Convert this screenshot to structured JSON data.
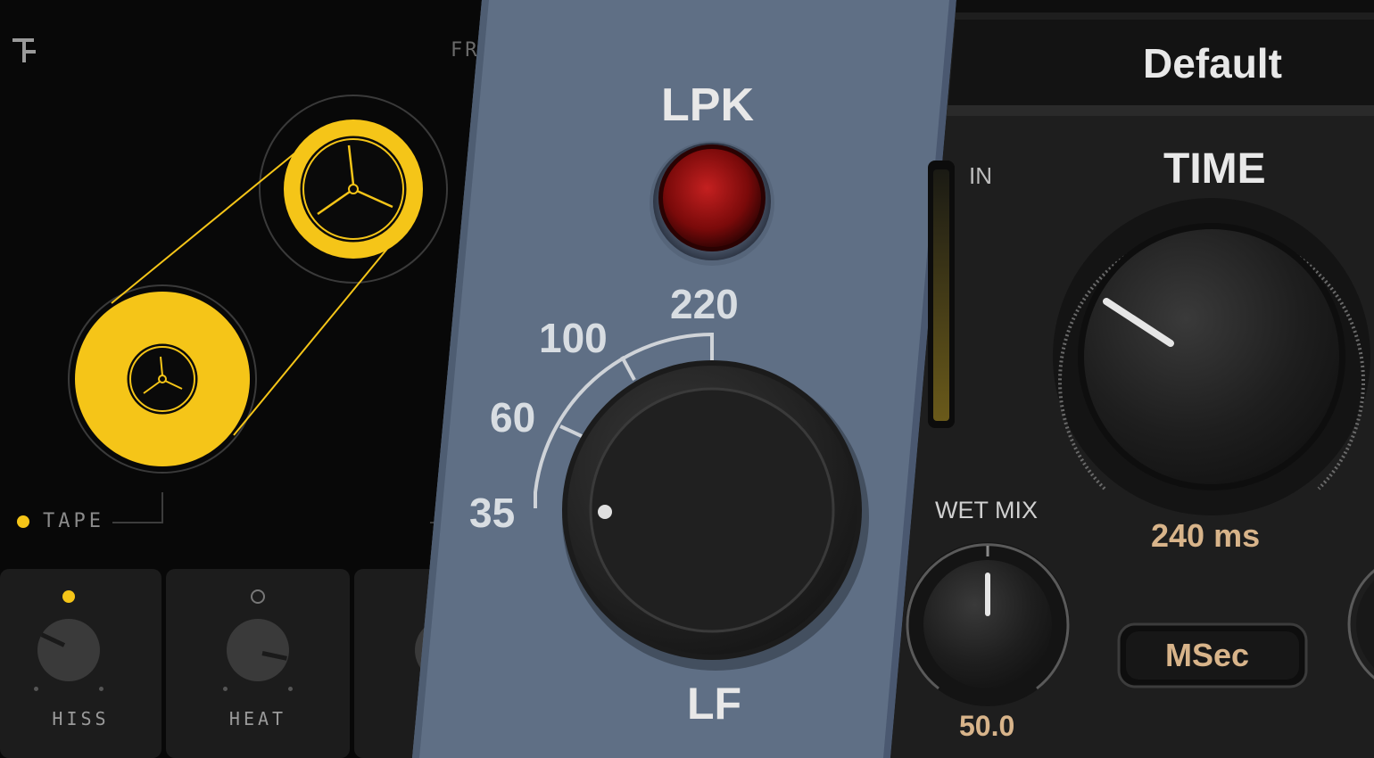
{
  "tape_panel": {
    "top_right_text": "FR",
    "tape_label": "TAPE",
    "knobs": [
      {
        "label": "HISS",
        "active": true,
        "value": 0.2
      },
      {
        "label": "HEAT",
        "active": false,
        "value": 0.8
      }
    ],
    "accent": "#f5c518"
  },
  "lpk_panel": {
    "title": "LPK",
    "indicator": "LED",
    "scale": [
      "35",
      "60",
      "100",
      "220"
    ],
    "knob_label": "LF",
    "knob_value": "35",
    "background": "#5f6f85"
  },
  "delay_panel": {
    "preset": "Default",
    "in_label": "IN",
    "time_label": "TIME",
    "time_value": "240 ms",
    "wet_mix_label": "WET MIX",
    "wet_mix_value": "50.0",
    "mode_button": "MSec",
    "value_color": "#d8b48a"
  }
}
